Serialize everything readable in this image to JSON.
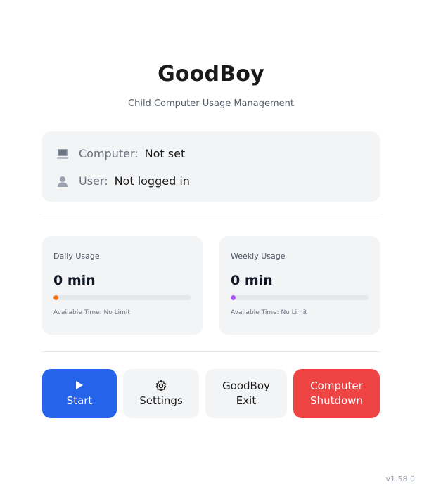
{
  "app": {
    "title": "GoodBoy",
    "subtitle": "Child Computer Usage Management",
    "version": "v1.58.0"
  },
  "info": {
    "computer": {
      "icon": "computer-icon",
      "label": "Computer:",
      "value": "Not set"
    },
    "user": {
      "icon": "user-icon",
      "label": "User:",
      "value": "Not logged in"
    }
  },
  "usage": {
    "daily": {
      "label": "Daily Usage",
      "value": "0 min",
      "progress_percent": 0,
      "color": "#f97316",
      "footer": "Available Time: No Limit"
    },
    "weekly": {
      "label": "Weekly Usage",
      "value": "0 min",
      "progress_percent": 0,
      "color": "#a855f7",
      "footer": "Available Time: No Limit"
    }
  },
  "buttons": {
    "start": {
      "icon": "play-icon",
      "label": "Start",
      "color": "#2563eb"
    },
    "settings": {
      "icon": "gear-icon",
      "label": "Settings"
    },
    "exit": {
      "line1": "GoodBoy",
      "line2": "Exit"
    },
    "shutdown": {
      "line1": "Computer",
      "line2": "Shutdown",
      "color": "#ef4444"
    }
  }
}
